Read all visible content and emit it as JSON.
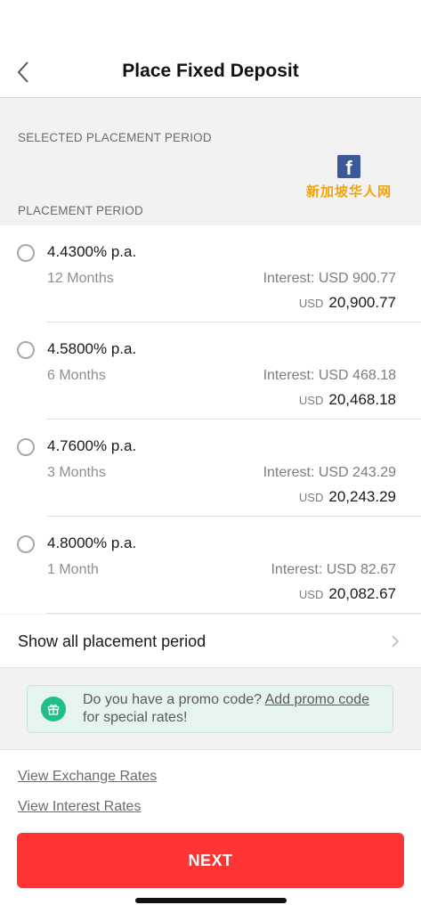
{
  "header": {
    "title": "Place Fixed Deposit"
  },
  "sections": {
    "selected_label": "SELECTED PLACEMENT PERIOD",
    "period_label": "PLACEMENT PERIOD"
  },
  "watermark": {
    "fb": "f",
    "text": "新加坡华人网"
  },
  "options": [
    {
      "rate": "4.4300% p.a.",
      "term": "12 Months",
      "interest": "Interest: USD 900.77",
      "currency": "USD",
      "total": "20,900.77"
    },
    {
      "rate": "4.5800% p.a.",
      "term": "6 Months",
      "interest": "Interest: USD 468.18",
      "currency": "USD",
      "total": "20,468.18"
    },
    {
      "rate": "4.7600% p.a.",
      "term": "3 Months",
      "interest": "Interest: USD 243.29",
      "currency": "USD",
      "total": "20,243.29"
    },
    {
      "rate": "4.8000% p.a.",
      "term": "1 Month",
      "interest": "Interest: USD 82.67",
      "currency": "USD",
      "total": "20,082.67"
    }
  ],
  "show_all": {
    "label": "Show all placement period"
  },
  "promo": {
    "text_before": "Do you have a promo code? ",
    "link": "Add promo code",
    "text_after": " for special rates!",
    "color": "#1fbf8a"
  },
  "links": {
    "exchange": "View Exchange Rates",
    "interest": "View Interest Rates"
  },
  "next_button": {
    "label": "NEXT",
    "color": "#ff3434"
  }
}
